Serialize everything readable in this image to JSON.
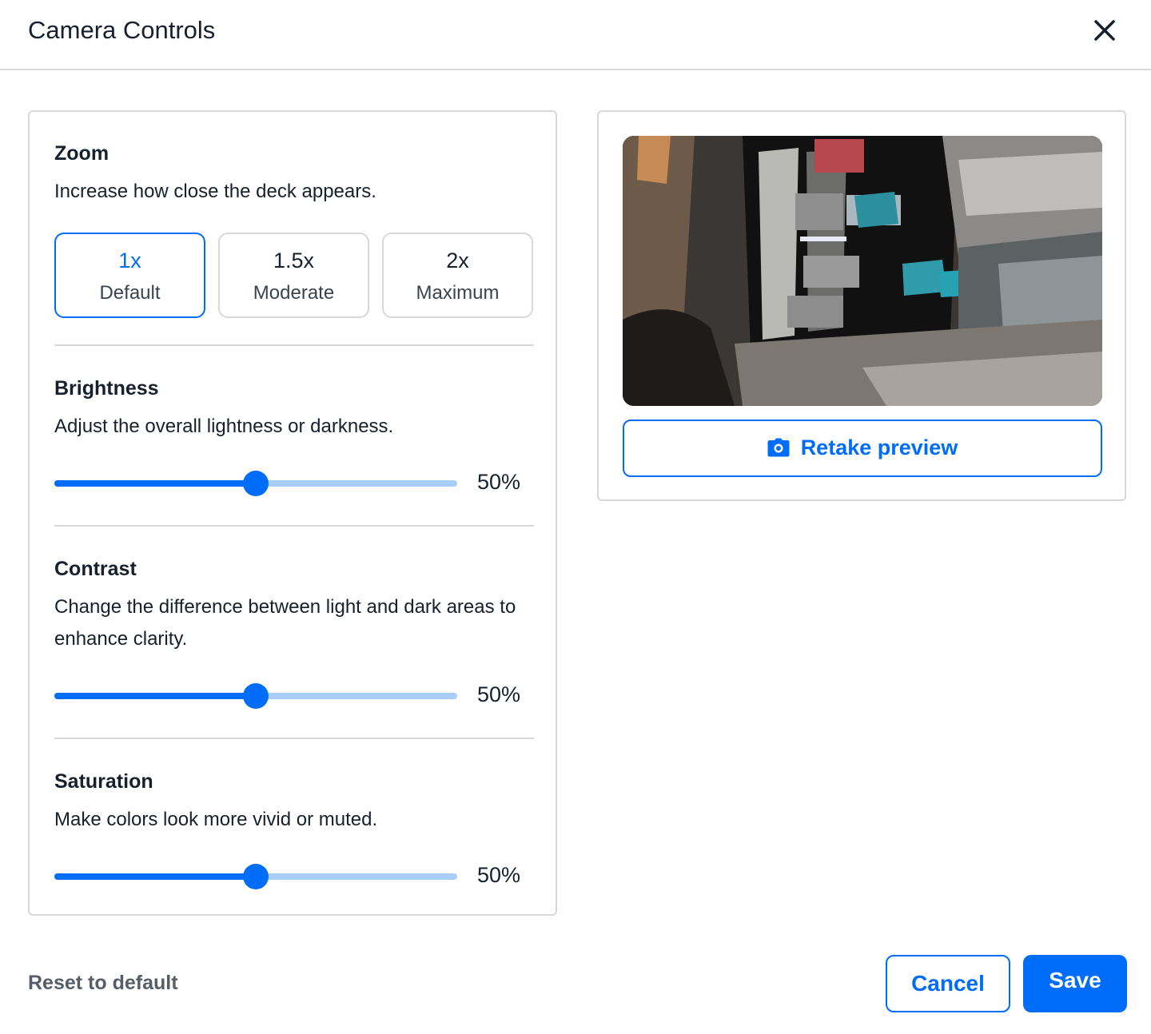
{
  "header": {
    "title": "Camera Controls"
  },
  "zoom": {
    "title": "Zoom",
    "description": "Increase how close the deck appears.",
    "options": [
      {
        "value": "1x",
        "label": "Default"
      },
      {
        "value": "1.5x",
        "label": "Moderate"
      },
      {
        "value": "2x",
        "label": "Maximum"
      }
    ],
    "selected": "1x"
  },
  "brightness": {
    "title": "Brightness",
    "description": "Adjust the overall lightness or darkness.",
    "value": 50,
    "value_label": "50%"
  },
  "contrast": {
    "title": "Contrast",
    "description": "Change the difference between light and dark areas to enhance clarity.",
    "value": 50,
    "value_label": "50%"
  },
  "saturation": {
    "title": "Saturation",
    "description": "Make colors look more vivid or muted.",
    "value": 50,
    "value_label": "50%"
  },
  "preview": {
    "retake_label": "Retake preview"
  },
  "footer": {
    "reset_label": "Reset to default",
    "cancel_label": "Cancel",
    "save_label": "Save"
  },
  "colors": {
    "accent": "#006cfa",
    "track": "#a8cdf8",
    "border": "#d8d8d8",
    "text": "#16212d"
  },
  "icons": {
    "close": "close-icon",
    "camera": "camera-icon"
  }
}
